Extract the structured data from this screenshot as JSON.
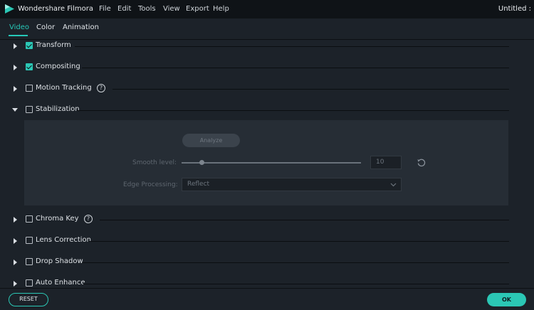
{
  "app": {
    "title": "Wondershare Filmora",
    "document_title": "Untitled :"
  },
  "menu": [
    "File",
    "Edit",
    "Tools",
    "View",
    "Export",
    "Help"
  ],
  "tabs": [
    {
      "label": "Video",
      "active": true
    },
    {
      "label": "Color",
      "active": false
    },
    {
      "label": "Animation",
      "active": false
    }
  ],
  "sections": [
    {
      "label": "Transform",
      "checked": true,
      "expanded": false,
      "help": false
    },
    {
      "label": "Compositing",
      "checked": true,
      "expanded": false,
      "help": false
    },
    {
      "label": "Motion Tracking",
      "checked": false,
      "expanded": false,
      "help": true
    },
    {
      "label": "Stabilization",
      "checked": false,
      "expanded": true,
      "help": false
    },
    {
      "label": "Chroma Key",
      "checked": false,
      "expanded": false,
      "help": true
    },
    {
      "label": "Lens Correction",
      "checked": false,
      "expanded": false,
      "help": false
    },
    {
      "label": "Drop Shadow",
      "checked": false,
      "expanded": false,
      "help": false
    },
    {
      "label": "Auto Enhance",
      "checked": false,
      "expanded": false,
      "help": false
    }
  ],
  "stabilization": {
    "analyze_label": "Analyze",
    "smooth_label": "Smooth level:",
    "smooth_value": "10",
    "edge_label": "Edge Processing:",
    "edge_value": "Reflect"
  },
  "footer": {
    "reset_label": "RESET",
    "ok_label": "OK"
  },
  "help_glyph": "?",
  "colors": {
    "accent": "#2bc7b5",
    "background": "#1c2229",
    "titlebar": "#0f1317",
    "panel": "#262d35"
  },
  "icons": {
    "logo": "filmora-logo-icon",
    "help": "help-icon",
    "reset": "reset-icon",
    "chevron": "chevron-down-icon"
  }
}
